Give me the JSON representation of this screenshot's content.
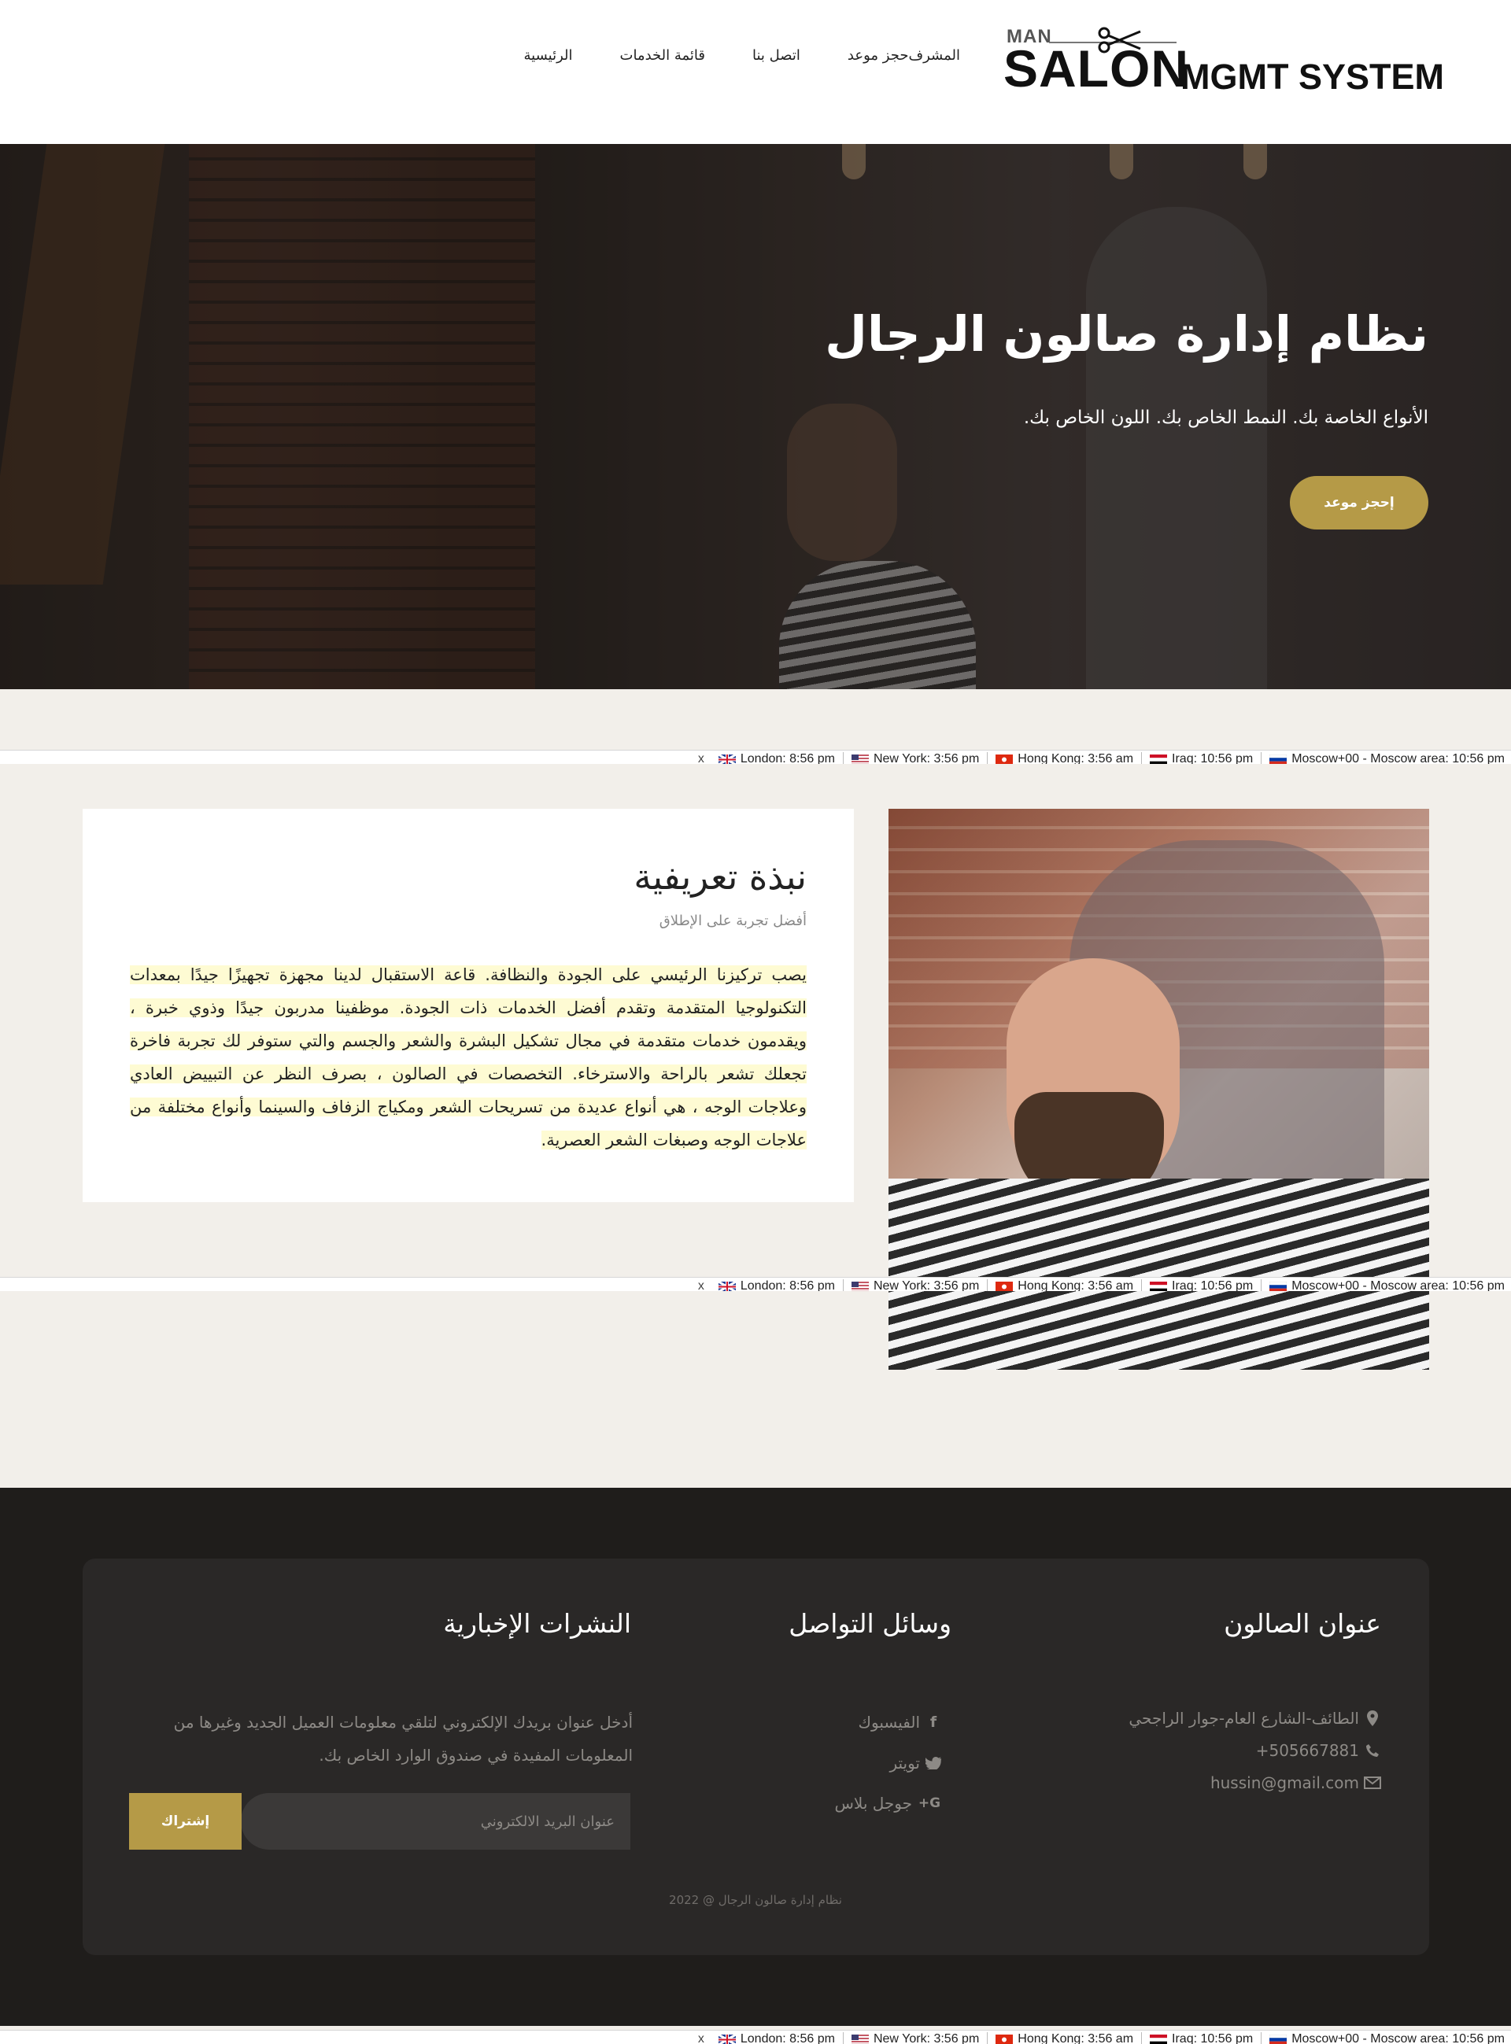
{
  "logo": {
    "man": "MAN",
    "salon": "SALON",
    "mgmt": "MGMT SYSTEM"
  },
  "nav": [
    "المشرف",
    "حجز موعد",
    "اتصل بنا",
    "قائمة الخدمات",
    "الرئيسية"
  ],
  "hero": {
    "title": "نظام إدارة صالون الرجال",
    "subtitle": "الأنواع الخاصة بك. النمط الخاص بك. اللون الخاص بك.",
    "button": "إحجز موعد"
  },
  "timebar": {
    "close": "x",
    "items": [
      {
        "label": "London: 8:56 pm",
        "flag_colors": [
          "#1f3a93",
          "#ffffff",
          "#cf142b"
        ]
      },
      {
        "label": "New York: 3:56 pm",
        "flag_colors": [
          "#3c3b6e",
          "#ffffff",
          "#b22234"
        ]
      },
      {
        "label": "Hong Kong: 3:56 am",
        "flag_colors": [
          "#de2910",
          "#de2910",
          "#ffffff"
        ]
      },
      {
        "label": "Iraq: 10:56 pm",
        "flag_colors": [
          "#ce1126",
          "#ffffff",
          "#000000"
        ]
      },
      {
        "label": "Moscow+00 - Moscow area: 10:56 pm",
        "flag_colors": [
          "#ffffff",
          "#0039a6",
          "#d52b1e"
        ]
      }
    ]
  },
  "about": {
    "title": "نبذة تعريفية",
    "subtitle": "أفضل تجربة على الإطلاق",
    "body": "يصب تركيزنا الرئيسي على الجودة والنظافة. قاعة الاستقبال لدينا مجهزة تجهيزًا جيدًا بمعدات التكنولوجيا المتقدمة وتقدم أفضل الخدمات ذات الجودة. موظفينا مدربون جيدًا وذوي خبرة ، ويقدمون خدمات متقدمة في مجال تشكيل البشرة والشعر والجسم والتي ستوفر لك تجربة فاخرة تجعلك تشعر بالراحة والاسترخاء. التخصصات في الصالون ، بصرف النظر عن التبييض العادي وعلاجات الوجه ، هي أنواع عديدة من تسريحات الشعر ومكياج الزفاف والسينما وأنواع مختلفة من علاجات الوجه وصبغات الشعر العصرية."
  },
  "footer": {
    "address": {
      "title": "عنوان الصالون",
      "location": "الطائف-الشارع العام-جوار الراجحي",
      "phone": "505667881+",
      "email": "hussin@gmail.com"
    },
    "social": {
      "title": "وسائل التواصل",
      "facebook": "الفيسبوك",
      "twitter": "تويتر",
      "google": "جوجل بلاس"
    },
    "newsletter": {
      "title": "النشرات الإخبارية",
      "text": "أدخل عنوان بريدك الإلكتروني لتلقي معلومات العميل الجديد وغيرها من المعلومات المفيدة في صندوق الوارد الخاص بك.",
      "placeholder": "عنوان البريد الالكتروني",
      "button": "إشتراك"
    },
    "copyright": "نظام إدارة صالون الرجال @ 2022"
  },
  "colors": {
    "accent": "#b59a47",
    "footer_bg": "#1f1d1b",
    "footer_box": "#2a2827",
    "page_bg": "#f2efea"
  }
}
